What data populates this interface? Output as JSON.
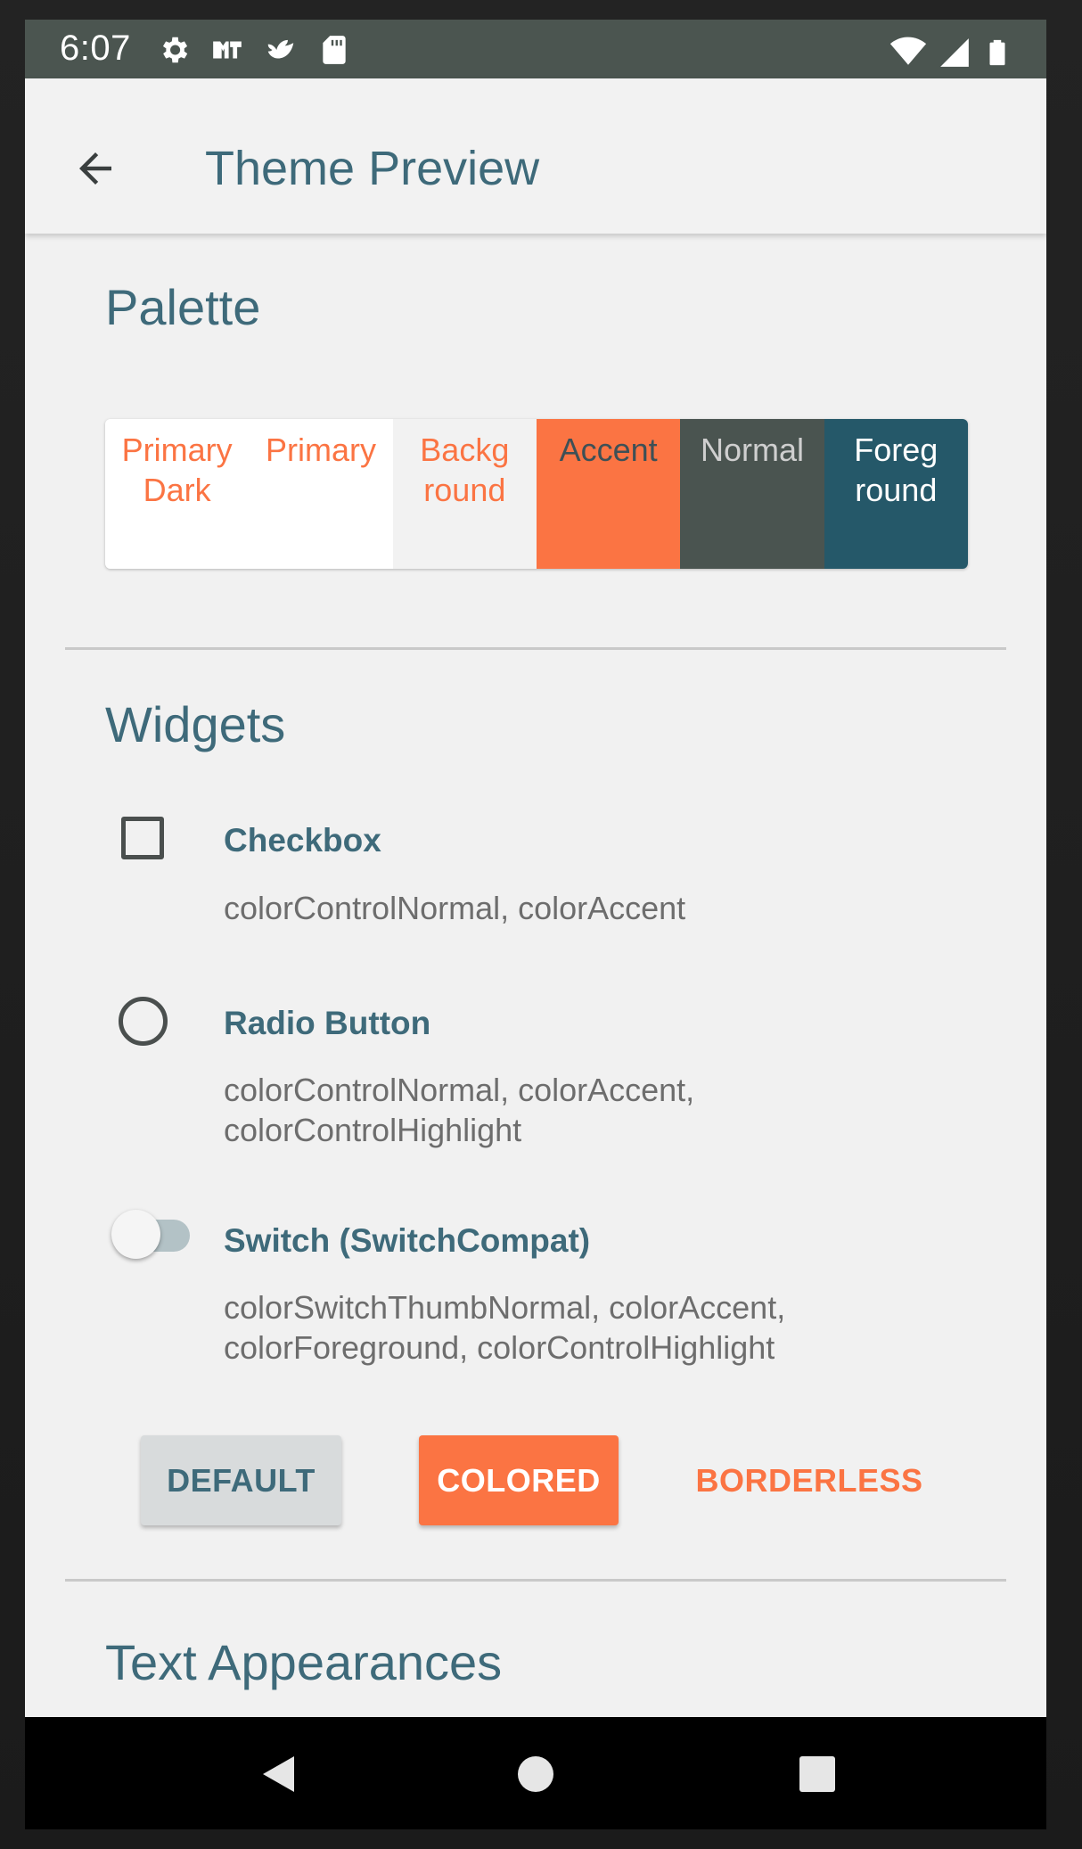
{
  "status_bar": {
    "time": "6:07",
    "left_icons": [
      "settings-gear-icon",
      "app-notification-icon",
      "bird-notification-icon",
      "sd-card-icon"
    ],
    "right_icons": [
      "wifi-icon",
      "cell-signal-icon",
      "battery-icon"
    ]
  },
  "app_bar": {
    "back_icon": "arrow-left-icon",
    "title": "Theme Preview"
  },
  "palette": {
    "title": "Palette",
    "swatches": [
      {
        "label": "Primary\nDark",
        "bg": "#ffffff",
        "fg": "#fb7443"
      },
      {
        "label": "Primary",
        "bg": "#ffffff",
        "fg": "#fb7443"
      },
      {
        "label": "Backg\nround",
        "bg": "#f2f2f2",
        "fg": "#fb7443"
      },
      {
        "label": "Accent",
        "bg": "#fb7443",
        "fg": "#3e5056"
      },
      {
        "label": "Normal",
        "bg": "#4a5450",
        "fg": "#cfcfcf"
      },
      {
        "label": "Foreg\nround",
        "bg": "#255869",
        "fg": "#ffffff"
      }
    ]
  },
  "widgets": {
    "title": "Widgets",
    "checkbox": {
      "label": "Checkbox",
      "desc": "colorControlNormal, colorAccent",
      "checked": false
    },
    "radio": {
      "label": "Radio Button",
      "desc_line1": "colorControlNormal, colorAccent,",
      "desc_line2": "colorControlHighlight",
      "selected": false
    },
    "switch": {
      "label": "Switch (SwitchCompat)",
      "desc_line1": "colorSwitchThumbNormal, colorAccent,",
      "desc_line2": "colorForeground, colorControlHighlight",
      "on": false
    },
    "buttons": {
      "default": "DEFAULT",
      "colored": "COLORED",
      "borderless": "BORDERLESS"
    }
  },
  "text_appearances": {
    "title": "Text Appearances"
  },
  "nav_bar": {
    "icons": [
      "back-triangle-icon",
      "home-circle-icon",
      "recents-square-icon"
    ]
  },
  "colors": {
    "accent": "#fb7443",
    "title_text": "#3e6a7a",
    "status_bar": "#4b5550",
    "foreground": "#255869"
  }
}
